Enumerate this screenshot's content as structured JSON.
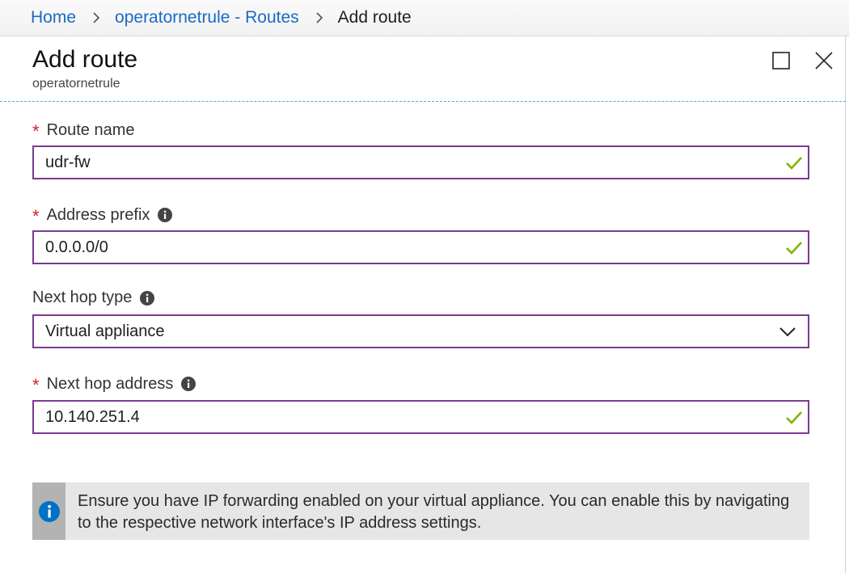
{
  "breadcrumb": {
    "home": "Home",
    "routes": "operatornetrule - Routes",
    "current": "Add route"
  },
  "blade": {
    "title": "Add route",
    "subtitle": "operatornetrule"
  },
  "form": {
    "route_name": {
      "label": "Route name",
      "value": "udr-fw",
      "required": true,
      "valid": true
    },
    "address_prefix": {
      "label": "Address prefix",
      "value": "0.0.0.0/0",
      "required": true,
      "valid": true
    },
    "next_hop_type": {
      "label": "Next hop type",
      "selected": "Virtual appliance",
      "required": false
    },
    "next_hop_address": {
      "label": "Next hop address",
      "value": "10.140.251.4",
      "required": true,
      "valid": true
    }
  },
  "info_banner": {
    "text": "Ensure you have IP forwarding enabled on your virtual appliance. You can enable this by navigating to the respective network interface's IP address settings."
  },
  "colors": {
    "link": "#1a6ac2",
    "input_border": "#7a3b91",
    "required_star": "#d81b29",
    "valid_check": "#7ab800",
    "info_blue": "#0072c6"
  },
  "icons": {
    "required": "*",
    "valid": "check-icon",
    "info": "info-icon",
    "dropdown": "chevron-down-icon",
    "maximize": "maximize-icon",
    "close": "close-icon",
    "separator": "chevron-right-icon"
  }
}
